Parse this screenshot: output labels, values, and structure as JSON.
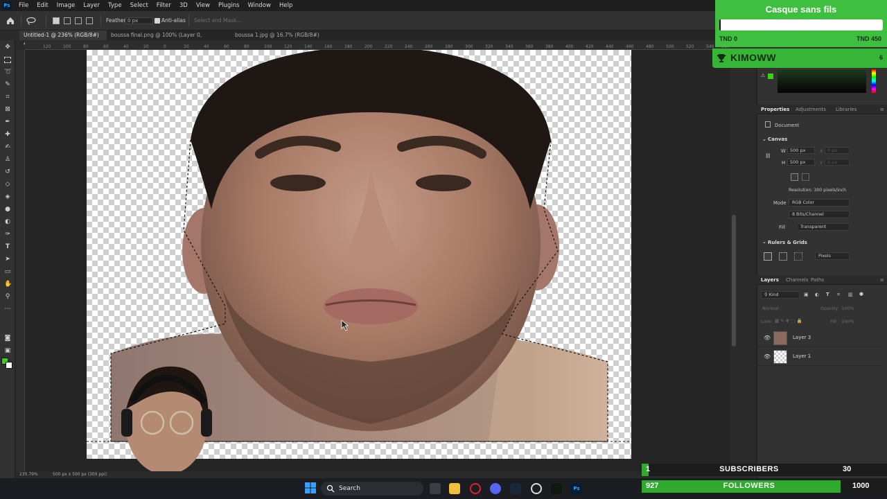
{
  "menubar": {
    "logo": "Ps",
    "items": [
      "File",
      "Edit",
      "Image",
      "Layer",
      "Type",
      "Select",
      "Filter",
      "3D",
      "View",
      "Plugins",
      "Window",
      "Help"
    ]
  },
  "options": {
    "feather_label": "Feather:",
    "feather_value": "0 px",
    "antialias_label": "Anti-alias",
    "select_mask": "Select and Mask..."
  },
  "tabs": [
    {
      "label": "Untitled-1 @ 236% (RGB/8#) *",
      "active": true
    },
    {
      "label": "boussa final.png @ 100% (Layer 0, RGB/8#) *",
      "active": false
    },
    {
      "label": "boussa 1.jpg @ 16.7% (RGB/8#) *",
      "active": false
    }
  ],
  "ruler_ticks": [
    "120",
    "100",
    "80",
    "60",
    "40",
    "20",
    "0",
    "20",
    "40",
    "60",
    "80",
    "100",
    "120",
    "140",
    "160",
    "180",
    "200",
    "220",
    "240",
    "260",
    "280",
    "300",
    "320",
    "340",
    "360",
    "380",
    "400",
    "420",
    "440",
    "460",
    "480",
    "500",
    "520",
    "540",
    "560"
  ],
  "status": {
    "zoom": "235.79%",
    "doc_size": "500 px x 500 px (300 ppi)"
  },
  "properties": {
    "tabs": [
      "Properties",
      "Adjustments",
      "Libraries"
    ],
    "document_label": "Document",
    "canvas_heading": "Canvas",
    "w_label": "W",
    "w_value": "500 px",
    "h_label": "H",
    "h_value": "500 px",
    "x_label": "X",
    "y_label": "Y",
    "x_value": "0 px",
    "y_value": "0 px",
    "resolution": "Resolution: 300 pixels/inch",
    "mode_label": "Mode",
    "mode_value": "RGB Color",
    "bits_value": "8 Bits/Channel",
    "fill_label": "Fill",
    "fill_value": "Transparent",
    "rulers_heading": "Rulers & Grids",
    "units_value": "Pixels"
  },
  "layers": {
    "tabs": [
      "Layers",
      "Channels",
      "Paths"
    ],
    "kind_label": "Kind",
    "blend_mode": "Normal",
    "opacity_label": "Opacity:",
    "opacity_value": "100%",
    "lock_label": "Lock:",
    "fill_label": "Fill:",
    "fill_value": "100%",
    "items": [
      {
        "name": "Layer 3",
        "visible": true
      },
      {
        "name": "Layer 1",
        "visible": true
      }
    ]
  },
  "taskbar": {
    "search_placeholder": "Search"
  },
  "overlay": {
    "goal_title": "Casque sans fils",
    "goal_min": "TND 0",
    "goal_max": "TND 450",
    "goal_progress": 0.01,
    "leader_name": "KIMOWW",
    "leader_count": "6",
    "subscribers_current": "1",
    "subscribers_label": "SUBSCRIBERS",
    "subscribers_target": "30",
    "subscribers_progress": 0.0333,
    "followers_current": "927",
    "followers_label": "FOLLOWERS",
    "followers_target": "1000",
    "followers_progress": 0.927
  },
  "colors": {
    "foreground": "#39d11a",
    "background": "#ffffff",
    "overlay_green": "#3fbf3f"
  },
  "icons": {
    "home": "home-icon",
    "lasso": "lasso-icon",
    "trophy": "trophy-icon",
    "windows": "windows-start-icon"
  }
}
